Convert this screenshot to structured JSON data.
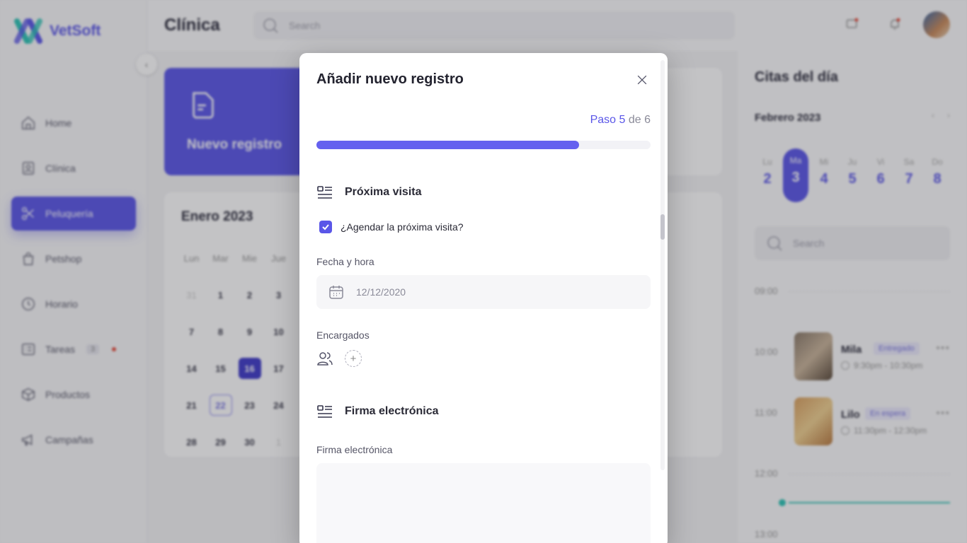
{
  "app": {
    "logo_text": "VetSoft",
    "page_title": "Clínica",
    "search_placeholder": "Search"
  },
  "sidebar": {
    "items": [
      {
        "label": "Home",
        "icon": "home-icon",
        "active": false
      },
      {
        "label": "Clínica",
        "icon": "clinic-badge-icon",
        "active": false
      },
      {
        "label": "Peluquería",
        "icon": "scissors-icon",
        "active": true
      },
      {
        "label": "Petshop",
        "icon": "shopping-bag-icon",
        "active": false
      },
      {
        "label": "Horario",
        "icon": "clock-icon",
        "active": false
      },
      {
        "label": "Tareas",
        "icon": "tasks-icon",
        "active": false,
        "badge": "3"
      },
      {
        "label": "Productos",
        "icon": "box-icon",
        "active": false
      },
      {
        "label": "Campañas",
        "icon": "megaphone-icon",
        "active": false
      }
    ]
  },
  "new_record_card": {
    "label": "Nuevo registro"
  },
  "calendar": {
    "title": "Enero 2023",
    "headers": [
      "Lun",
      "Mar",
      "Mie",
      "Jue"
    ],
    "rows": [
      [
        "31",
        "1",
        "2",
        "3"
      ],
      [
        "7",
        "8",
        "9",
        "10"
      ],
      [
        "14",
        "15",
        "16",
        "17"
      ],
      [
        "21",
        "22",
        "23",
        "24"
      ],
      [
        "28",
        "29",
        "30",
        "1"
      ]
    ],
    "selected": "16",
    "today": "22"
  },
  "appointments": {
    "title": "Citas del día",
    "month": "Febrero 2023",
    "week": [
      {
        "name": "Lu",
        "num": "2"
      },
      {
        "name": "Ma",
        "num": "3",
        "active": true
      },
      {
        "name": "Mi",
        "num": "4"
      },
      {
        "name": "Ju",
        "num": "5"
      },
      {
        "name": "Vi",
        "num": "6"
      },
      {
        "name": "Sa",
        "num": "7"
      },
      {
        "name": "Do",
        "num": "8"
      }
    ],
    "search_placeholder": "Search",
    "hours": [
      "09:00",
      "10:00",
      "11:00",
      "12:00",
      "13:00"
    ],
    "items": [
      {
        "name": "Mila",
        "status": "Entregado",
        "time": "9:30pm - 10:30pm"
      },
      {
        "name": "Lilo",
        "status": "En espera",
        "time": "11:30pm - 12:30pm"
      }
    ]
  },
  "modal": {
    "title": "Añadir nuevo registro",
    "step_label": "Paso",
    "step_current": "5",
    "step_of": "de",
    "step_total": "6",
    "progress_fraction": 0.785,
    "section_next_visit": "Próxima visita",
    "schedule_checkbox_label": "¿Agendar la próxima visita?",
    "schedule_checked": true,
    "date_label": "Fecha y hora",
    "date_value": "12/12/2020",
    "assignees_label": "Encargados",
    "section_signature": "Firma electrónica",
    "signature_label": "Firma electrónica"
  },
  "colors": {
    "accent": "#5a56e8",
    "progress": "#6561ef",
    "logo_teal": "#2ec4b6"
  }
}
